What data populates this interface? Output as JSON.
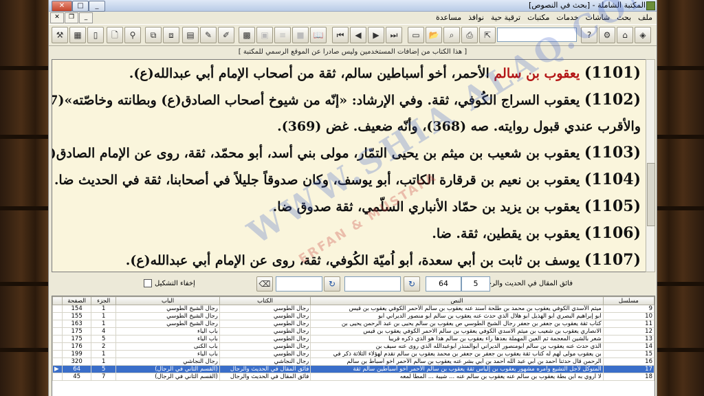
{
  "window": {
    "title": "المكتبة الشاملة - [بحث في النصوص]"
  },
  "menu": [
    "ملف",
    "بحث",
    "شاشات",
    "خدمات",
    "مكتبات",
    "ترقية حية",
    "نوافذ",
    "مساعدة"
  ],
  "notice": "[ هذا الكتاب من إضافات المستخدمين وليس صادرا عن الموقع الرسمي للمكتبة ]",
  "text": {
    "paras": [
      {
        "num": "(1101)",
        "red": "يعقوب بن سالم",
        "rest": " الأحمر، أخو أسباطين سالم، ثقة من أصحاب الإمام أبي عبدالله(ع)."
      },
      {
        "num": "(1102)",
        "red": "",
        "rest": " يعقوب السراج الكُوفي، ثقة. وفي الإرشاد: «إنّه من شيوخ أصحاب الصادق(ع) وبطانته وخاصّته»(367). الخ."
      },
      {
        "num": "",
        "red": "",
        "rest": "والأقرب عندي قبول روايته. صه (368)، وأنّه ضعيف. غض (369)."
      },
      {
        "num": "(1103)",
        "red": "",
        "rest": " يعقوب بن شعيب بن ميثم بن يحيى التمّار، مولى بني أسد، أبو محمّد، ثقة، روى عن الإمام الصادق(ع)."
      },
      {
        "num": "(1104)",
        "red": "",
        "rest": " يعقوب بن نعيم بن قرقارة الكاتب، أبو يوسف، وكان صدوقاً جليلاً في أصحابنا، ثقة في الحديث ضا."
      },
      {
        "num": "(1105)",
        "red": "",
        "rest": " يعقوب بن يزيد بن حمّاد الأنباري السلّمي، ثقة صدوق ضا."
      },
      {
        "num": "(1106)",
        "red": "",
        "rest": " يعقوب بن يقطين، ثقة. ضا."
      },
      {
        "num": "(1107)",
        "red": "",
        "rest": " يوسف بن ثابت بن أبي سعدة، أبو اُميّة الكُوفي، ثقة، روى عن الإمام أبي عبدالله(ع)."
      }
    ]
  },
  "controls": {
    "source_label": "فائق المقال في الحديث والرجال",
    "field_part": "5",
    "field_page": "64",
    "hide_tashkeel": "إخفاء التشكيل"
  },
  "grid": {
    "headers": {
      "serial": "مسلسل",
      "text": "النص",
      "book": "الكتاب",
      "chapter": "الباب",
      "part": "الجزء",
      "page": "الصفحة"
    },
    "rows": [
      {
        "serial": "9",
        "text": "ميثم الأسدي الكوفي يعقوب بن محمد بن طلحة أسند عنه يعقوب بن سالم الأحمر الكوفي يعقوب بن قيس",
        "book": "رجال الطوسي",
        "chapter": "رجال الشيخ الطوسي",
        "part": "1",
        "page": "154",
        "sel": false
      },
      {
        "serial": "10",
        "text": "أبو إبراهيم البصري أبو الهذيل أبو هلال الذي حدث عنه يعقوب بن سالم أبو منصور الديراني أبو",
        "book": "رجال الطوسي",
        "chapter": "رجال الشيخ الطوسي",
        "part": "1",
        "page": "155",
        "sel": false
      },
      {
        "serial": "11",
        "text": "كتاب ثقة يعقوب بن جعفر بن جعفر رجال الشيخ الطوسي ص يعقوب بن سالم يحيى بن عبد الرحمن يحيى بن",
        "book": "رجال الطوسي",
        "chapter": "رجال الشيخ الطوسي",
        "part": "1",
        "page": "163",
        "sel": false
      },
      {
        "serial": "12",
        "text": "الانصاري يعقوب بن شعيب بن ميثم الاسدي الكوفي يعقوب بن سالم الاحمر الكوفي يعقوب بن قيس",
        "book": "رجال الطوسي",
        "chapter": "باب الياء",
        "part": "4",
        "page": "175",
        "sel": false
      },
      {
        "serial": "13",
        "text": "شعر بالشين المعجمة ثم العين المهملة بعدها راء يعقوب بن سالم هذا هو الذي ذكره قريبا",
        "book": "رجال الطوسي",
        "chapter": "باب الياء",
        "part": "5",
        "page": "175",
        "sel": false
      },
      {
        "serial": "14",
        "text": "الذي حدث عنه يعقوب بن سالم أبومنصور الديراني أبوالمنذر أبوعبدالله الذي روى عنه سيف بن",
        "book": "رجال الطوسي",
        "chapter": "باب الكنى",
        "part": "2",
        "page": "176",
        "sel": false
      },
      {
        "serial": "15",
        "text": "بن يعقوب مولى لهم له كتاب ثقة يعقوب بن جعفر بن جعفر بن محمد يعقوب بن سالم تقدم لهؤلاء الثلاثة ذكر في",
        "book": "رجال الطوسي",
        "chapter": "باب الياء",
        "part": "1",
        "page": "199",
        "sel": false
      },
      {
        "serial": "16",
        "text": "الرحمن قال حدثنا أحمد بن أبي عبد الله أحمد بن أبي بشر عنه يعقوب بن سالم الأحمر أخو أسباط بن سالم",
        "book": "رجال النجاشي",
        "chapter": "رجال النجاشي",
        "part": "1",
        "page": "320",
        "sel": false
      },
      {
        "serial": "17",
        "text": "المتوكل لأجل التشيع وأمره مشهور يعقوب بن إلياس ثقة يعقوب بن سالم الأحمر أخو أسباطين سالم ثقة",
        "book": "فائق المقال في الحديث والرجال",
        "chapter": "(القسم الثاني في الرجال)",
        "part": "5",
        "page": "64",
        "sel": true
      },
      {
        "serial": "18",
        "text": "لا أروي به ابن بطة يعقوب بن سالم عنه يعقوب بن سالم عنه ... شيبة ... المطا لمعه",
        "book": "فائق المقال في الحديث والرجال",
        "chapter": "(القسم الثاني في الرجال)",
        "part": "7",
        "page": "45",
        "sel": false
      }
    ]
  },
  "watermark": {
    "main": "WWW.SHIA ALAQ.COM",
    "sub": "ERFAN & MUSTAFA"
  }
}
